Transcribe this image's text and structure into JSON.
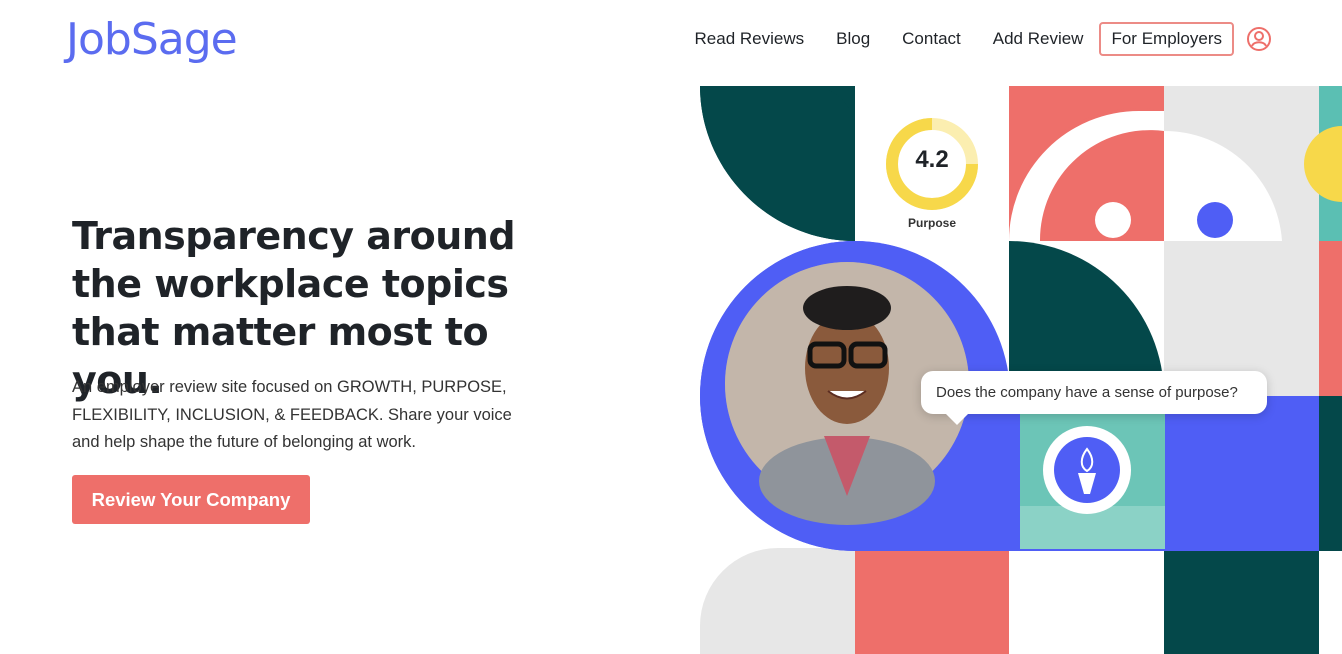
{
  "header": {
    "logo": "JobSage",
    "nav": [
      "Read Reviews",
      "Blog",
      "Contact",
      "Add Review"
    ],
    "employers_button": "For Employers"
  },
  "hero": {
    "title": "Transparency around the workplace topics that matter most to you.",
    "subtitle": "An employer review site focused on GROWTH, PURPOSE, FLEXIBILITY, INCLUSION, & FEEDBACK. Share your voice and help shape the future of belonging at work.",
    "cta": "Review Your Company"
  },
  "art": {
    "rating_value": "4.2",
    "rating_label": "Purpose",
    "bubble_text": "Does the company have a sense of purpose?"
  },
  "colors": {
    "brand": "#5b6cf0",
    "coral": "#ee6f6a",
    "dark_green": "#04484a",
    "teal": "#5bbfb3",
    "light_gray": "#e7e7e7",
    "blue": "#4f5ef5",
    "yellow": "#f7d84a"
  },
  "icons": [
    "logo-owl-icon",
    "user-icon",
    "torch-icon"
  ]
}
